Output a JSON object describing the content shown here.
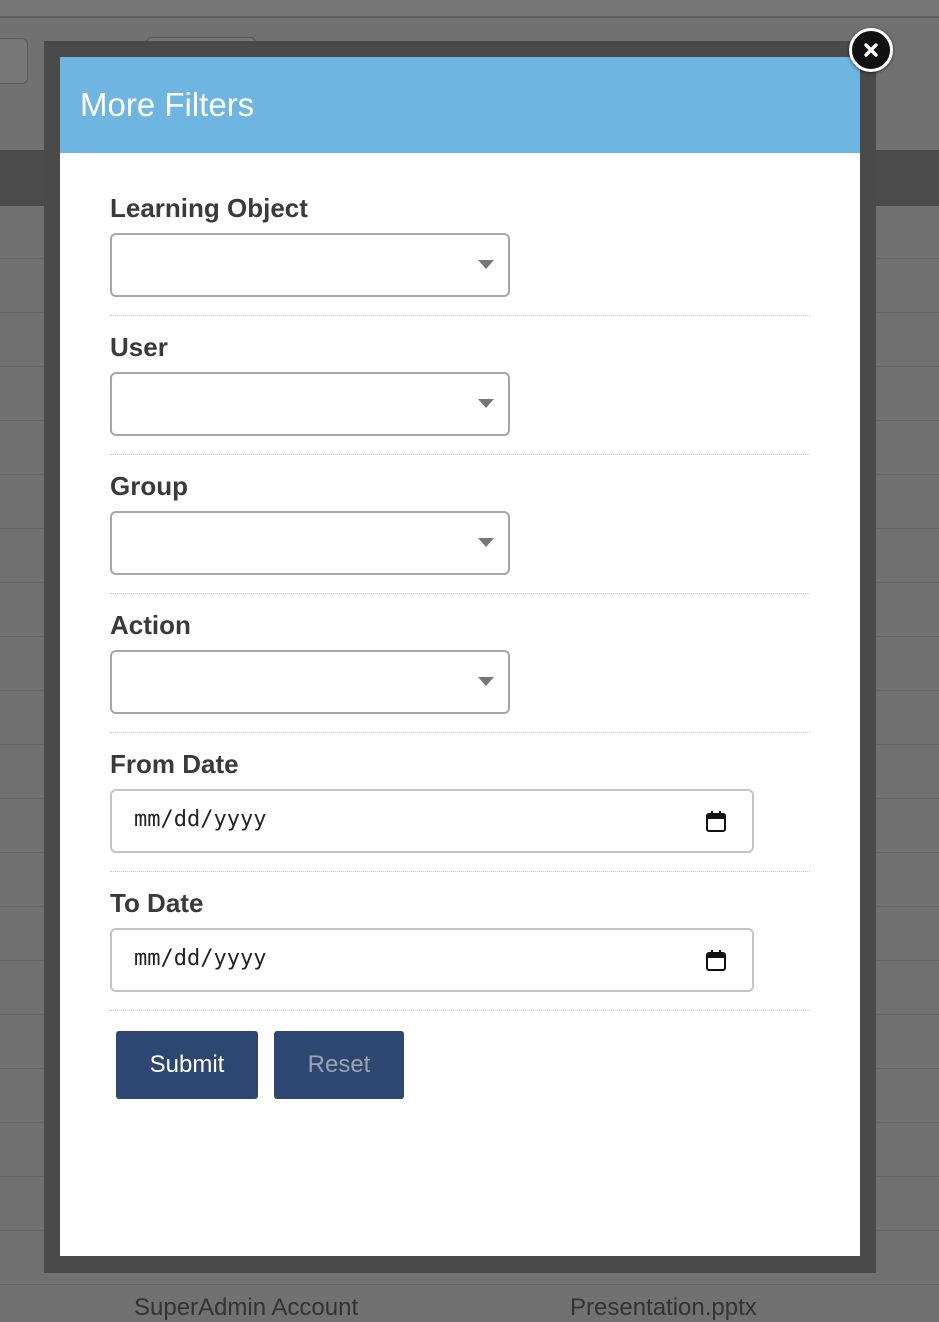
{
  "background": {
    "bottom_texts": [
      "SuperAdmin Account",
      "Presentation.pptx"
    ]
  },
  "modal": {
    "title": "More Filters",
    "close_icon": "close-icon",
    "fields": [
      {
        "label": "Learning Object",
        "type": "select",
        "value": ""
      },
      {
        "label": "User",
        "type": "select",
        "value": ""
      },
      {
        "label": "Group",
        "type": "select",
        "value": ""
      },
      {
        "label": "Action",
        "type": "select",
        "value": ""
      },
      {
        "label": "From Date",
        "type": "date",
        "placeholder": "mm/dd/yyyy"
      },
      {
        "label": "To Date",
        "type": "date",
        "placeholder": "mm/dd/yyyy"
      }
    ],
    "buttons": {
      "submit": "Submit",
      "reset": "Reset"
    }
  },
  "colors": {
    "header": "#6fb5e2",
    "button": "#2e4672",
    "overlay": "#717171"
  }
}
